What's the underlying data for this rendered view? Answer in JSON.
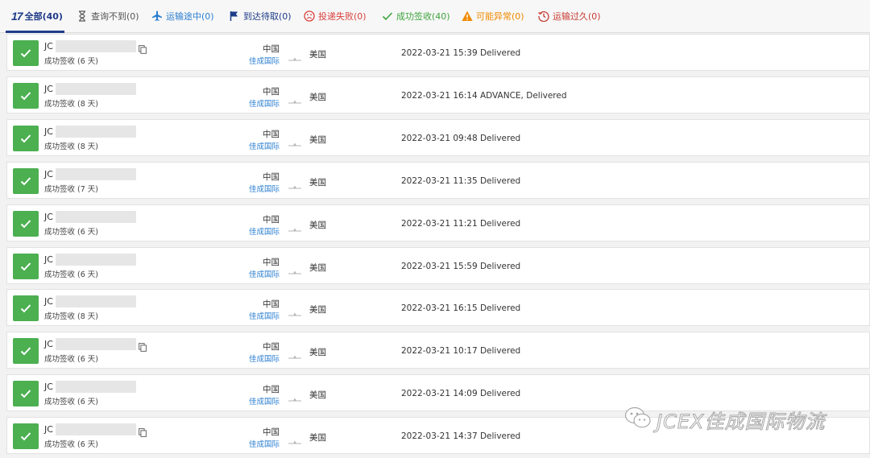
{
  "tabs": [
    {
      "label": "全部(40)",
      "icon": "logo-17track",
      "color": "#1f3c88",
      "active": true
    },
    {
      "label": "查询不到(0)",
      "icon": "hourglass-icon",
      "color": "#555555"
    },
    {
      "label": "运输途中(0)",
      "icon": "airplane-icon",
      "color": "#2a7ed0"
    },
    {
      "label": "到达待取(0)",
      "icon": "flag-icon",
      "color": "#1f3c88"
    },
    {
      "label": "投递失败(0)",
      "icon": "sad-face-icon",
      "color": "#d9413c"
    },
    {
      "label": "成功签收(40)",
      "icon": "checkmark-icon",
      "color": "#3ea43b"
    },
    {
      "label": "可能异常(0)",
      "icon": "warning-triangle-icon",
      "color": "#f08a00"
    },
    {
      "label": "运输过久(0)",
      "icon": "history-clock-icon",
      "color": "#c73b33"
    }
  ],
  "logo_text": "17",
  "shipments": [
    {
      "tracking": "JC",
      "status": "成功签收 (6 天)",
      "origin": "中国",
      "carrier": "佳成国际",
      "dest": "美国",
      "event": "2022-03-21 15:39  Delivered",
      "copy": true
    },
    {
      "tracking": "JC",
      "status": "成功签收 (8 天)",
      "origin": "中国",
      "carrier": "佳成国际",
      "dest": "美国",
      "event": "2022-03-21 16:14  ADVANCE, Delivered",
      "copy": false
    },
    {
      "tracking": "JC",
      "status": "成功签收 (8 天)",
      "origin": "中国",
      "carrier": "佳成国际",
      "dest": "美国",
      "event": "2022-03-21 09:48  Delivered",
      "copy": false
    },
    {
      "tracking": "JC",
      "status": "成功签收 (7 天)",
      "origin": "中国",
      "carrier": "佳成国际",
      "dest": "美国",
      "event": "2022-03-21 11:35  Delivered",
      "copy": false
    },
    {
      "tracking": "JC",
      "status": "成功签收 (6 天)",
      "origin": "中国",
      "carrier": "佳成国际",
      "dest": "美国",
      "event": "2022-03-21 11:21  Delivered",
      "copy": false
    },
    {
      "tracking": "JC",
      "status": "成功签收 (6 天)",
      "origin": "中国",
      "carrier": "佳成国际",
      "dest": "美国",
      "event": "2022-03-21 15:59  Delivered",
      "copy": false
    },
    {
      "tracking": "JC",
      "status": "成功签收 (8 天)",
      "origin": "中国",
      "carrier": "佳成国际",
      "dest": "美国",
      "event": "2022-03-21 16:15  Delivered",
      "copy": false
    },
    {
      "tracking": "JC",
      "status": "成功签收 (6 天)",
      "origin": "中国",
      "carrier": "佳成国际",
      "dest": "美国",
      "event": "2022-03-21 10:17  Delivered",
      "copy": true
    },
    {
      "tracking": "JC",
      "status": "成功签收 (6 天)",
      "origin": "中国",
      "carrier": "佳成国际",
      "dest": "美国",
      "event": "2022-03-21 14:09  Delivered",
      "copy": false
    },
    {
      "tracking": "JC",
      "status": "成功签收 (6 天)",
      "origin": "中国",
      "carrier": "佳成国际",
      "dest": "美国",
      "event": "2022-03-21 14:37  Delivered",
      "copy": true
    }
  ],
  "watermark": {
    "text": "JCEX佳成国际物流",
    "icon": "wechat-icon"
  },
  "colors": {
    "success": "#4caf50",
    "accent": "#1f3c88",
    "link": "#2a7ed0"
  }
}
